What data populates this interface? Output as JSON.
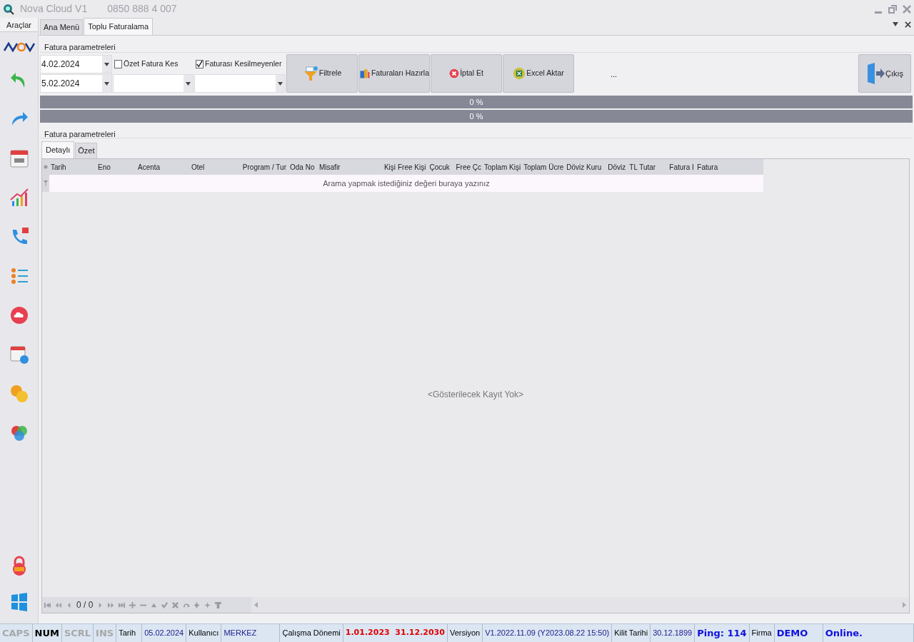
{
  "window": {
    "title": "Nova Cloud V1",
    "phone": "0850 888 4 007"
  },
  "sidebar": {
    "title": "Araçlar"
  },
  "tabs": [
    {
      "label": "Ana Menü",
      "selected": false
    },
    {
      "label": "Toplu Faturalama",
      "selected": true
    }
  ],
  "params": {
    "title": "Fatura parametreleri",
    "date_from": "4.02.2024",
    "date_to": "5.02.2024",
    "checks": [
      {
        "label": "Özet Fatura Kes",
        "checked": false
      },
      {
        "label": "Faturası Kesilmeyenler",
        "checked": true
      }
    ]
  },
  "buttons": [
    {
      "label": "Filtrele"
    },
    {
      "label": "Faturaları Hazırla"
    },
    {
      "label": "İptal Et"
    },
    {
      "label": "Excel Aktar"
    }
  ],
  "more": "...",
  "exit": "Çıkış",
  "progress": [
    {
      "level": 0,
      "reading": "0 %"
    },
    {
      "level": 0,
      "reading": "0 %"
    }
  ],
  "section_title": "Fatura parametreleri",
  "subtabs": [
    {
      "label": "Detaylı",
      "selected": true
    },
    {
      "label": "Özet",
      "selected": false
    }
  ],
  "table": {
    "columns": [
      "Tarih",
      "Eno",
      "Acenta",
      "Otel",
      "Program / Tur",
      "Oda No",
      "Misafir",
      "Kişi",
      "Free Kişi",
      "Çocuk",
      "Free Çc",
      "Toplam Kişi",
      "Toplam Ücre",
      "Döviz Kuru",
      "Döviz",
      "TL Tutar",
      "Fatura I",
      "Fatura"
    ],
    "search_placeholder": "Arama yapmak istediğiniz değeri buraya yazınız",
    "empty": "<Gösterilecek Kayıt Yok>",
    "record_count": "0 / 0"
  },
  "status_bar": [
    {
      "kind": "key",
      "text": "CAPS",
      "on": false
    },
    {
      "kind": "key",
      "text": "NUM",
      "on": true
    },
    {
      "kind": "key",
      "text": "SCRL",
      "on": false
    },
    {
      "kind": "key",
      "text": "INS",
      "on": false
    },
    {
      "kind": "label",
      "text": "Tarih"
    },
    {
      "kind": "value",
      "text": "05.02.2024"
    },
    {
      "kind": "label",
      "text": "Kullanıcı"
    },
    {
      "kind": "value",
      "text": "MERKEZ"
    },
    {
      "kind": "label",
      "text": "Çalışma Dönemi"
    },
    {
      "kind": "alert",
      "text": "1.01.2023  31.12.2030"
    },
    {
      "kind": "label",
      "text": "Versiyon"
    },
    {
      "kind": "value",
      "text": "V1.2022.11.09 (Y2023.08.22 15:50)"
    },
    {
      "kind": "label",
      "text": "Kilit Tarihi"
    },
    {
      "kind": "value",
      "text": "30.12.1899"
    },
    {
      "kind": "strong",
      "text": "Ping: 114"
    },
    {
      "kind": "label",
      "text": "Firma"
    },
    {
      "kind": "strong",
      "text": "DEMO"
    },
    {
      "kind": "strong",
      "text": "Online."
    }
  ]
}
